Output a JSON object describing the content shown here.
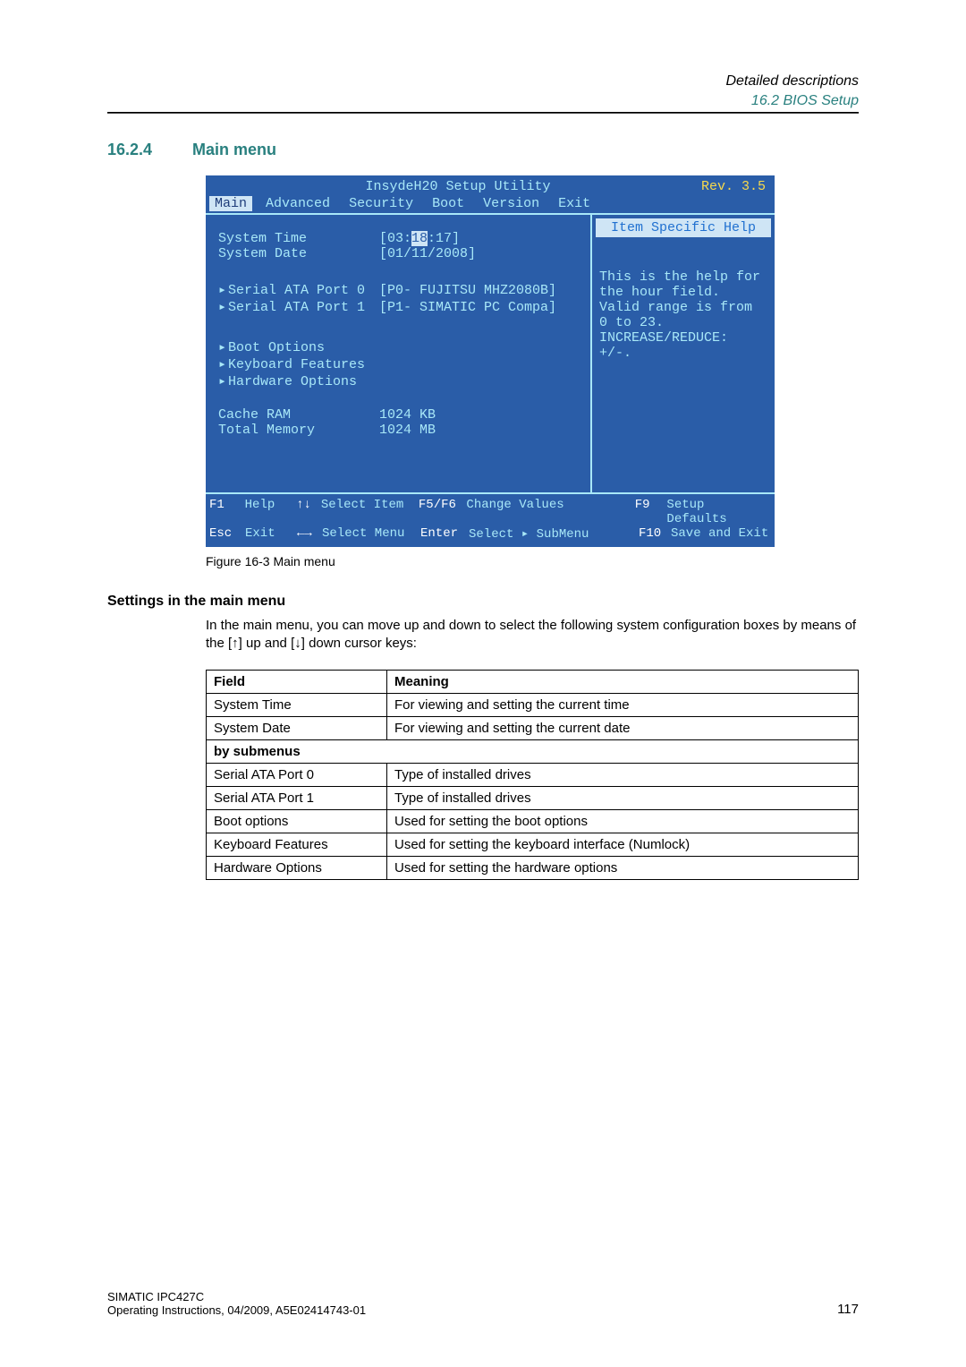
{
  "header": {
    "title": "Detailed descriptions",
    "subtitle": "16.2 BIOS Setup"
  },
  "section": {
    "number": "16.2.4",
    "title": "Main menu"
  },
  "bios": {
    "title_center": "InsydeH20 Setup Utility",
    "rev": "Rev. 3.5",
    "tabs": [
      "Main",
      "Advanced",
      "Security",
      "Boot",
      "Version",
      "Exit"
    ],
    "help_title": "Item Specific Help",
    "help_text": "This is the help for the hour field. Valid range is from 0 to 23. INCREASE/REDUCE: +/-.",
    "rows": {
      "system_time_label": "System Time",
      "system_time_value_pre": "[03:",
      "system_time_value_sel": "18",
      "system_time_value_post": ":17]",
      "system_date_label": "System Date",
      "system_date_value": "[01/11/2008]",
      "sata0_label": "Serial ATA Port 0",
      "sata0_value": "[P0- FUJITSU MHZ2080B]",
      "sata1_label": "Serial ATA Port 1",
      "sata1_value": "[P1- SIMATIC PC Compa]",
      "boot_options": "Boot Options",
      "keyboard_features": "Keyboard Features",
      "hardware_options": "Hardware Options",
      "cache_ram_label": "Cache RAM",
      "cache_ram_value": "1024 KB",
      "total_mem_label": "Total Memory",
      "total_mem_value": "1024 MB"
    },
    "footer": {
      "f1": "F1",
      "f1_label": "Help",
      "arrows_v": "↑↓",
      "arrows_v_label": "Select Item",
      "f5f6": "F5/F6",
      "f5f6_label": "Change Values",
      "f9": "F9",
      "f9_label": "Setup Defaults",
      "esc": "Esc",
      "esc_label": "Exit",
      "arrows_h": "←→",
      "arrows_h_label": "Select Menu",
      "enter": "Enter",
      "enter_label": "Select ▸ SubMenu",
      "f10": "F10",
      "f10_label": "Save and Exit"
    }
  },
  "figure_caption": "Figure 16-3    Main menu",
  "settings_heading": "Settings in the main menu",
  "settings_text": "In the main menu, you can move up and down to select the following system configuration boxes by means of the [↑] up and [↓] down cursor keys:",
  "table": {
    "header_field": "Field",
    "header_meaning": "Meaning",
    "rows": [
      {
        "field": "System Time",
        "meaning": "For viewing and setting the current time"
      },
      {
        "field": "System Date",
        "meaning": "For viewing and setting the current date"
      }
    ],
    "sub_header": "by submenus",
    "sub_rows": [
      {
        "field": "Serial ATA Port 0",
        "meaning": "Type of installed drives"
      },
      {
        "field": "Serial ATA Port 1",
        "meaning": "Type of installed drives"
      },
      {
        "field": "Boot options",
        "meaning": "Used for setting the boot options"
      },
      {
        "field": "Keyboard Features",
        "meaning": "Used for setting the keyboard interface (Numlock)"
      },
      {
        "field": "Hardware Options",
        "meaning": "Used for setting the hardware options"
      }
    ]
  },
  "footer": {
    "line1": "SIMATIC IPC427C",
    "line2": "Operating Instructions, 04/2009, A5E02414743-01",
    "page": "117"
  }
}
